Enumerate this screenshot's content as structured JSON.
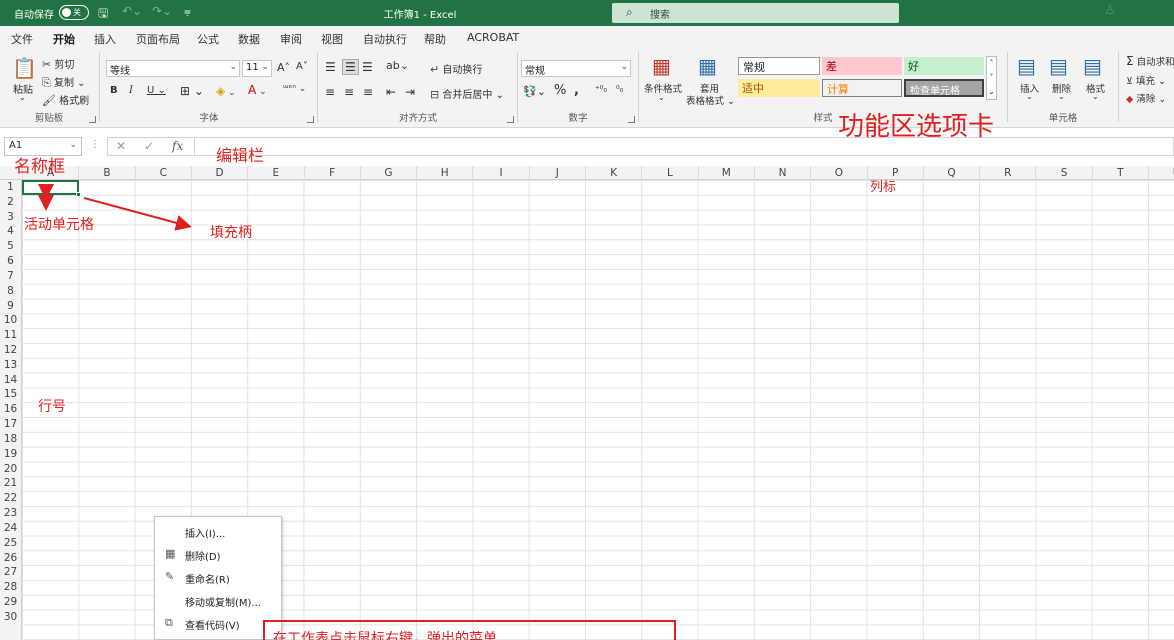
{
  "titlebar": {
    "autosave_label": "自动保存",
    "toggle_state": "关",
    "title": "工作簿1 - Excel",
    "search_placeholder": "搜索"
  },
  "tabs": [
    "文件",
    "开始",
    "插入",
    "页面布局",
    "公式",
    "数据",
    "审阅",
    "视图",
    "自动执行",
    "帮助",
    "ACROBAT"
  ],
  "active_tab": "开始",
  "ribbon": {
    "clipboard": {
      "paste": "粘贴",
      "cut": "剪切",
      "copy": "复制",
      "format_painter": "格式刷",
      "label": "剪贴板"
    },
    "font": {
      "font_name": "等线",
      "font_size": "11",
      "label": "字体"
    },
    "alignment": {
      "wrap_text": "自动换行",
      "merge_center": "合并后居中",
      "label": "对齐方式"
    },
    "number": {
      "format": "常规",
      "label": "数字"
    },
    "styles": {
      "conditional_format": "条件格式",
      "table_format_1": "套用",
      "table_format_2": "表格格式",
      "cells": [
        "常规",
        "差",
        "好",
        "适中",
        "计算",
        "检查单元格"
      ],
      "label": "样式"
    },
    "cells_group": {
      "insert": "插入",
      "delete": "删除",
      "format": "格式",
      "label": "单元格"
    },
    "editing": {
      "autosum": "自动求和",
      "fill": "填充",
      "clear": "清除"
    }
  },
  "formula_bar": {
    "name_box": "A1"
  },
  "columns": [
    "A",
    "B",
    "C",
    "D",
    "E",
    "F",
    "G",
    "H",
    "I",
    "J",
    "K",
    "L",
    "M",
    "N",
    "O",
    "P",
    "Q",
    "R",
    "S",
    "T",
    "U"
  ],
  "rows": [
    "1",
    "2",
    "3",
    "4",
    "5",
    "6",
    "7",
    "8",
    "9",
    "10",
    "11",
    "12",
    "13",
    "14",
    "15",
    "16",
    "17",
    "18",
    "19",
    "20",
    "21",
    "22",
    "23",
    "24",
    "25",
    "26",
    "27",
    "28",
    "29",
    "30"
  ],
  "context_menu": [
    {
      "label": "插入(I)...",
      "icon": "none"
    },
    {
      "label": "删除(D)",
      "icon": "delete-sheet-icon"
    },
    {
      "label": "重命名(R)",
      "icon": "rename-icon"
    },
    {
      "label": "移动或复制(M)...",
      "icon": "none"
    },
    {
      "label": "查看代码(V)",
      "icon": "view-code-icon"
    }
  ],
  "annotations": {
    "name_box": "名称框",
    "formula_bar": "编辑栏",
    "ribbon_tabs": "功能区选项卡",
    "active_cell": "活动单元格",
    "fill_handle": "填充柄",
    "column_header": "列标",
    "row_header": "行号",
    "context_callout": "在工作表点击鼠标右键，弹出的菜单"
  },
  "colors": {
    "excel_green": "#217346",
    "annotation_red": "#e02020"
  }
}
